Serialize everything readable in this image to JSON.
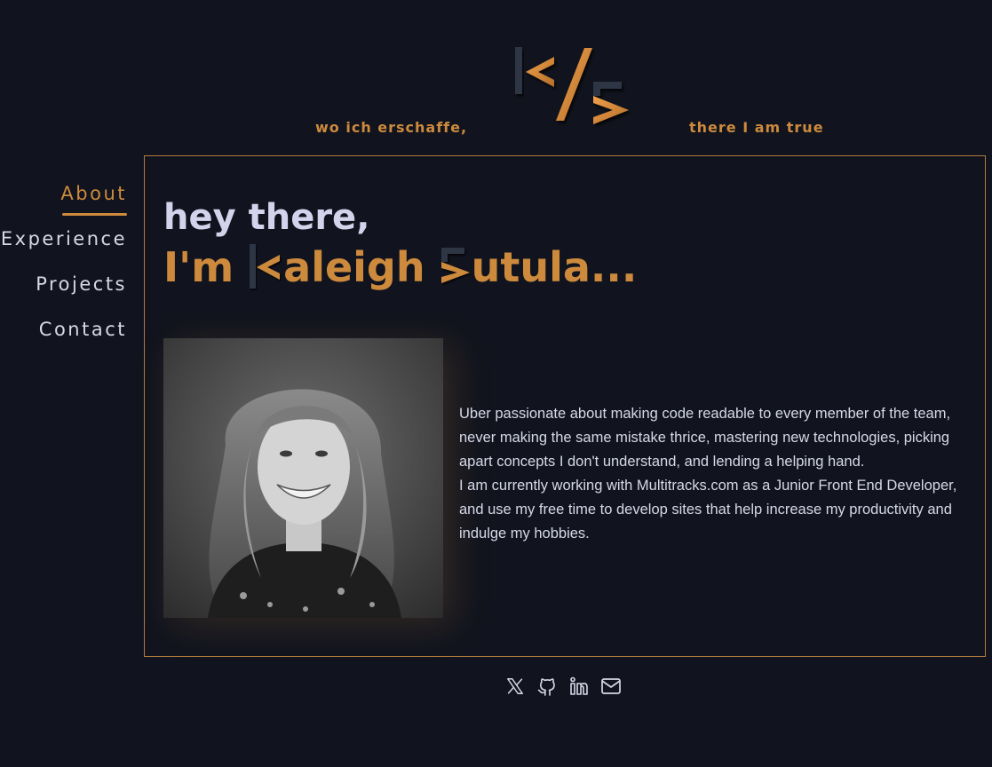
{
  "header": {
    "tagline_left": "wo ich erschaffe,",
    "tagline_right": "there I am true"
  },
  "nav": {
    "items": [
      {
        "label": "About",
        "active": true
      },
      {
        "label": "Experience",
        "active": false
      },
      {
        "label": "Projects",
        "active": false
      },
      {
        "label": "Contact",
        "active": false
      }
    ]
  },
  "hero": {
    "greeting": "hey there,",
    "name_prefix": "I'm ",
    "name_middle": "aleigh ",
    "name_suffix": "utula..."
  },
  "about": {
    "paragraph_1": "Uber passionate about making code readable to every member of the team, never making the same mistake thrice, mastering new technologies, picking apart concepts I don't understand, and lending a helping hand.",
    "paragraph_2": "I am currently working with Multitracks.com as a Junior Front End Developer, and use my free time to develop sites that help increase my productivity and indulge my hobbies."
  },
  "social": {
    "icons": [
      "x-icon",
      "github-icon",
      "linkedin-icon",
      "mail-icon"
    ]
  },
  "colors": {
    "background": "#11141e",
    "accent": "#cd8a3d",
    "text": "#d6d8e8",
    "slate": "#2e3644"
  }
}
